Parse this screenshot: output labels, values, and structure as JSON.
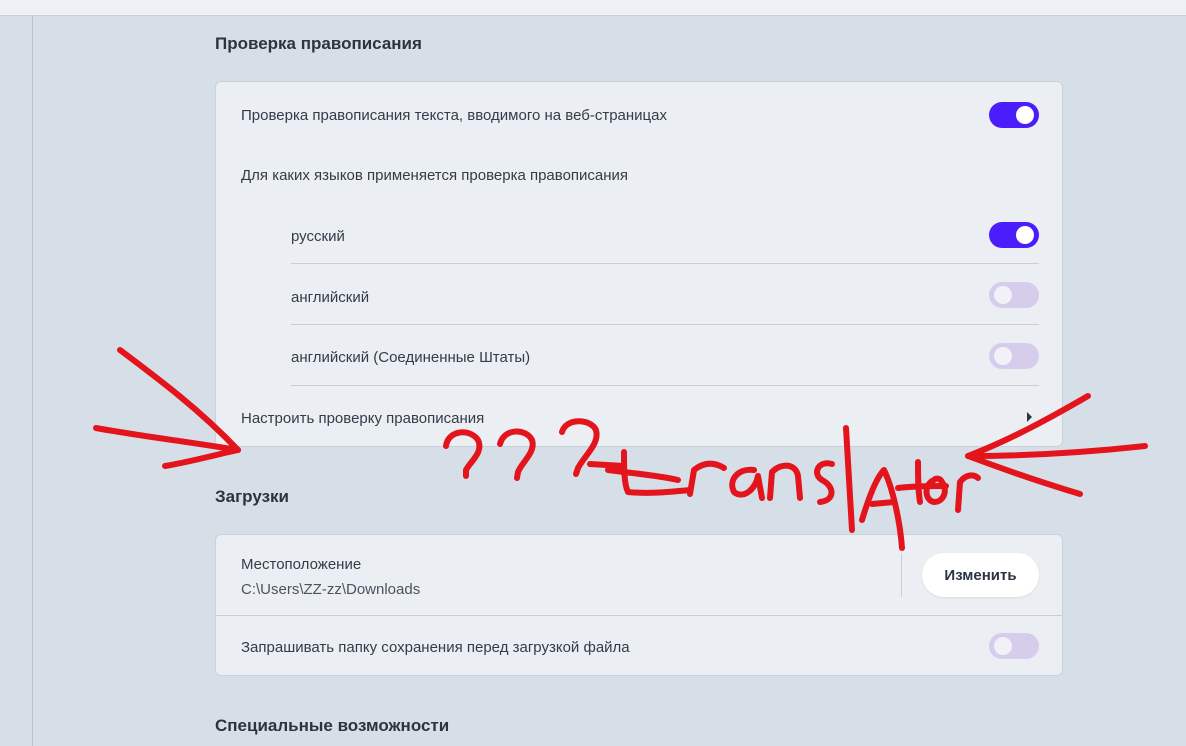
{
  "spellcheck": {
    "title": "Проверка правописания",
    "enable_label": "Проверка правописания текста, вводимого на веб-страницах",
    "enable_on": true,
    "languages_heading": "Для каких языков применяется проверка правописания",
    "languages": [
      {
        "label": "русский",
        "on": true
      },
      {
        "label": "английский",
        "on": false
      },
      {
        "label": "английский (Соединенные Штаты)",
        "on": false
      }
    ],
    "customize_label": "Настроить проверку правописания"
  },
  "downloads": {
    "title": "Загрузки",
    "location_label": "Местоположение",
    "location_path": "C:\\Users\\ZZ-zz\\Downloads",
    "change_button": "Изменить",
    "ask_label": "Запрашивать папку сохранения перед загрузкой файла",
    "ask_on": false
  },
  "accessibility": {
    "title": "Специальные возможности"
  },
  "annotation": {
    "text": "???-translator",
    "color": "#e3141b"
  },
  "colors": {
    "accent": "#4a1dfa",
    "toggle_off": "#d6ccec",
    "page_bg": "#d6dfe8",
    "card_bg": "#ebeff3"
  }
}
